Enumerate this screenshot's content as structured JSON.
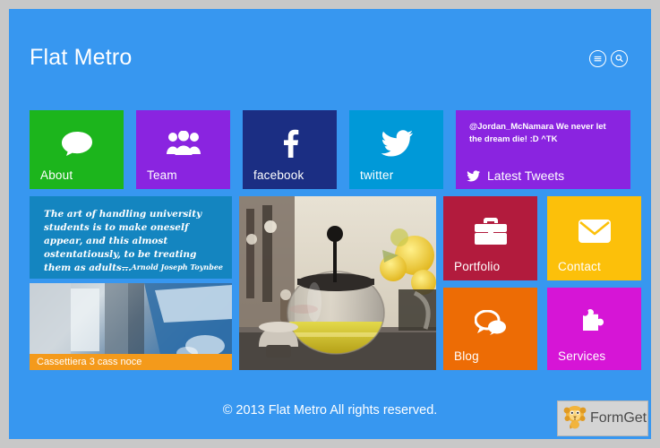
{
  "site": {
    "brand": "Flat Metro",
    "footer": "© 2013 Flat Metro All rights reserved."
  },
  "header": {
    "menu_icon": "hamburger-menu-icon",
    "search_icon": "search-icon"
  },
  "tiles": {
    "about": {
      "label": "About",
      "icon": "speech-bubble-icon",
      "color": "#1cb51c"
    },
    "team": {
      "label": "Team",
      "icon": "people-group-icon",
      "color": "#8a24e0"
    },
    "facebook": {
      "label": "facebook",
      "icon": "facebook-f-icon",
      "color": "#1b2e83"
    },
    "twitter": {
      "label": "twitter",
      "icon": "twitter-bird-icon",
      "color": "#0099d8"
    },
    "portfolio": {
      "label": "Portfolio",
      "icon": "briefcase-icon",
      "color": "#b21b3d"
    },
    "contact": {
      "label": "Contact",
      "icon": "envelope-icon",
      "color": "#fcc00a"
    },
    "blog": {
      "label": "Blog",
      "icon": "comments-icon",
      "color": "#ed6c05"
    },
    "services": {
      "label": "Services",
      "icon": "puzzle-piece-icon",
      "color": "#d615d6"
    }
  },
  "tweets": {
    "text": "@Jordan_McNamara We never let the dream die! :D ^TK",
    "label": "Latest Tweets",
    "icon": "twitter-bird-icon",
    "color": "#8a24e0"
  },
  "quote": {
    "text": "The art of handling university students is to make oneself appear, and this almost ostentatiously, to be treating them as adults...",
    "author": "— Arnold Joseph Toynbee",
    "color": "#1485c0"
  },
  "photo_tile": {
    "caption": "Cassettiera 3 cass noce",
    "caption_color": "#f49a1b"
  },
  "big_photo": {
    "alt": "glass teapot with yellow tea, cup and yellow roses"
  },
  "watermark": {
    "label": "FormGet",
    "icon": "lion-mascot-icon"
  }
}
